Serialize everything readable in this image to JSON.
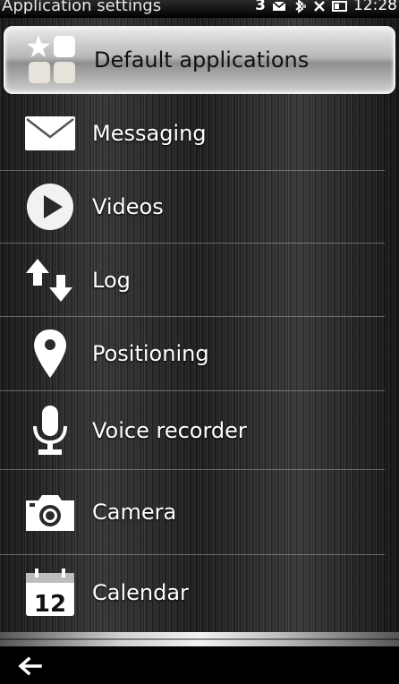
{
  "status_bar": {
    "title": "Application settings",
    "signal_label": "3",
    "time": "12:28",
    "icons": [
      "signal-3g-icon",
      "envelope-icon",
      "bluetooth-icon",
      "no-signal-icon",
      "battery-icon"
    ]
  },
  "menu": {
    "items": [
      {
        "label": "Default applications",
        "icon": "default-apps-icon",
        "highlighted": true
      },
      {
        "label": "Messaging",
        "icon": "envelope-icon"
      },
      {
        "label": "Videos",
        "icon": "play-icon"
      },
      {
        "label": "Log",
        "icon": "log-arrows-icon"
      },
      {
        "label": "Positioning",
        "icon": "location-pin-icon"
      },
      {
        "label": "Voice recorder",
        "icon": "microphone-icon"
      },
      {
        "label": "Camera",
        "icon": "camera-icon"
      },
      {
        "label": "Calendar",
        "icon": "calendar-icon",
        "day": "12"
      }
    ]
  },
  "toolbar": {
    "back_icon": "back-arrow-icon"
  },
  "colors": {
    "highlight_bg": "#cfcfcf",
    "text": "#ffffff",
    "highlight_text": "#101010",
    "divider": "#bebebe"
  }
}
